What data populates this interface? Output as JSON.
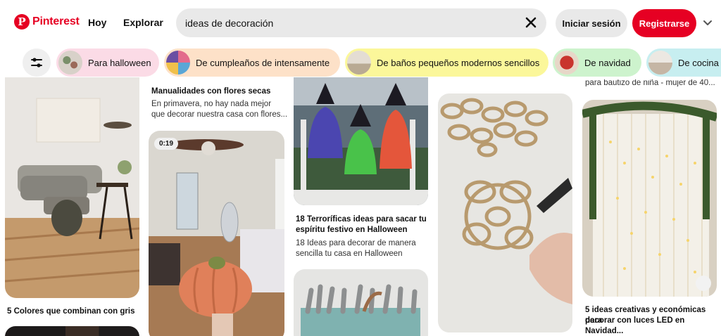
{
  "header": {
    "logo_mark": "P",
    "logo_text": "Pinterest",
    "nav": [
      "Hoy",
      "Explorar"
    ],
    "search_value": "ideas de decoración",
    "login_label": "Iniciar sesión",
    "signup_label": "Registrarse",
    "brand_color": "#e60023"
  },
  "filters": {
    "chips": [
      {
        "label": "Para halloween",
        "color": "#fbdbe6"
      },
      {
        "label": "De cumpleaños de intensamente",
        "color": "#fde1c8"
      },
      {
        "label": "De baños pequeños modernos sencillos",
        "color": "#fbf79a"
      },
      {
        "label": "De navidad",
        "color": "#cdf3cd"
      },
      {
        "label": "De cocina",
        "color": "#c7eef0"
      }
    ]
  },
  "pins": {
    "col1": {
      "title": "5 Colores que combinan con gris"
    },
    "col2": {
      "top_title": "Manualidades con flores secas",
      "top_desc_1": "En primavera, no hay nada mejor",
      "top_desc_2": "que decorar nuestra casa con flores...",
      "video_duration": "0:19"
    },
    "col3": {
      "title_1": "18 Terroríficas ideas para sacar tu",
      "title_2": "espíritu festivo en Halloween",
      "desc_1": "18 Ideas para decorar de manera",
      "desc_2": "sencilla tu casa en Halloween"
    },
    "col5": {
      "top_cut": "para bautizo de niña - mujer de 40...",
      "title_1": "5 ideas creativas y económicas para",
      "title_2": "decorar con luces LED en Navidad..."
    }
  },
  "icons": {
    "search_clear": "close-icon",
    "header_menu": "chevron-down-icon",
    "filters": "filter-sliders-icon",
    "pin_options": "camera-icon"
  }
}
